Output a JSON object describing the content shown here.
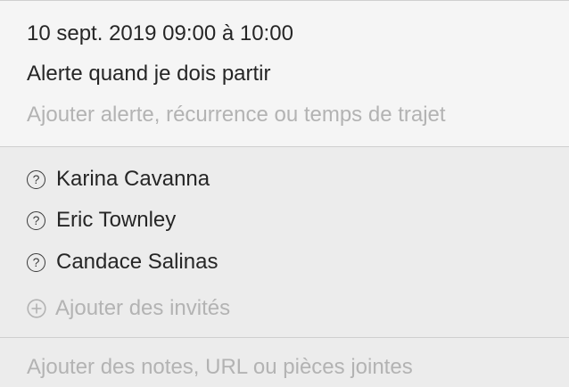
{
  "event": {
    "datetime": "10 sept. 2019  09:00 à 10:00",
    "alert": "Alerte quand je dois partir",
    "add_alert_placeholder": "Ajouter alerte, récurrence ou temps de trajet"
  },
  "invitees": {
    "status_glyph": "?",
    "items": [
      {
        "name": "Karina Cavanna",
        "status_icon": "question-circle-icon"
      },
      {
        "name": "Eric Townley",
        "status_icon": "question-circle-icon"
      },
      {
        "name": "Candace Salinas",
        "status_icon": "question-circle-icon"
      }
    ],
    "add_label": "Ajouter des invités",
    "add_icon": "plus-circle-icon"
  },
  "notes": {
    "placeholder": "Ajouter des notes, URL ou pièces jointes"
  },
  "colors": {
    "text_primary": "#262626",
    "text_placeholder": "#b3b3b3",
    "background_details": "#f5f5f5",
    "background_panel": "#ececec"
  }
}
